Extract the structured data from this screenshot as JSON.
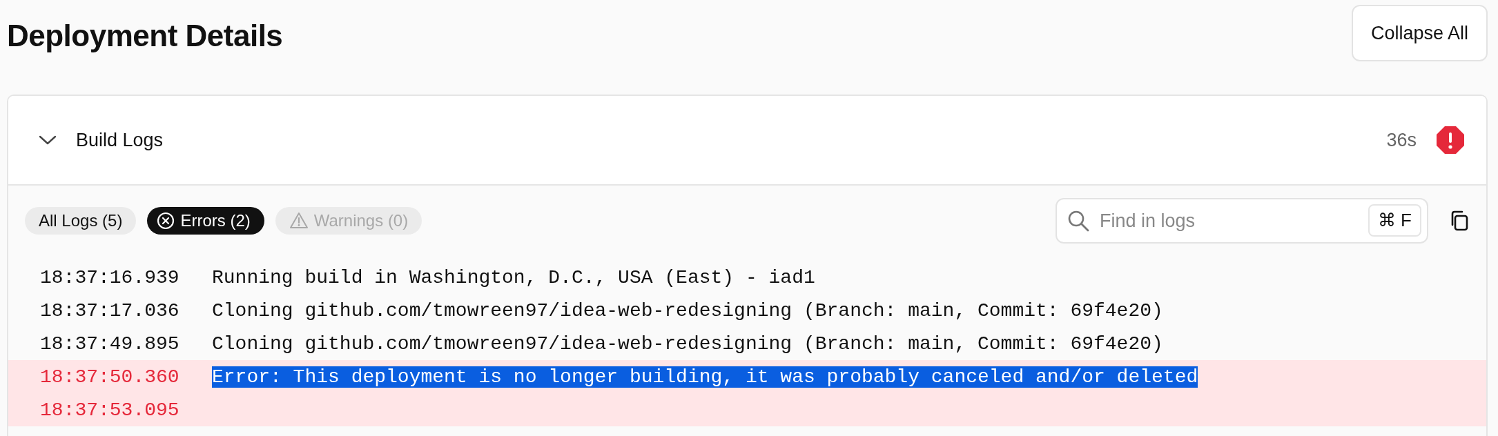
{
  "page": {
    "title": "Deployment Details",
    "collapse_button": "Collapse All"
  },
  "section": {
    "title": "Build Logs",
    "expanded": true,
    "duration": "36s"
  },
  "filters": [
    {
      "kind": "all",
      "label": "All Logs (5)",
      "selected": false,
      "disabled": false
    },
    {
      "kind": "error",
      "label": "Errors (2)",
      "selected": true,
      "disabled": false
    },
    {
      "kind": "warning",
      "label": "Warnings (0)",
      "selected": false,
      "disabled": true
    }
  ],
  "search": {
    "placeholder": "Find in logs",
    "shortcut": "⌘ F"
  },
  "logs": [
    {
      "kind": "info",
      "time": "18:37:16.939",
      "message": "Running build in Washington, D.C., USA (East) - iad1"
    },
    {
      "kind": "info",
      "time": "18:37:17.036",
      "message": "Cloning github.com/tmowreen97/idea-web-redesigning (Branch: main, Commit: 69f4e20)"
    },
    {
      "kind": "info",
      "time": "18:37:49.895",
      "message": "Cloning github.com/tmowreen97/idea-web-redesigning (Branch: main, Commit: 69f4e20)"
    },
    {
      "kind": "error",
      "time": "18:37:50.360",
      "message": "Error: This deployment is no longer building, it was probably canceled and/or deleted",
      "highlighted": true
    },
    {
      "kind": "error",
      "time": "18:37:53.095"
    }
  ]
}
